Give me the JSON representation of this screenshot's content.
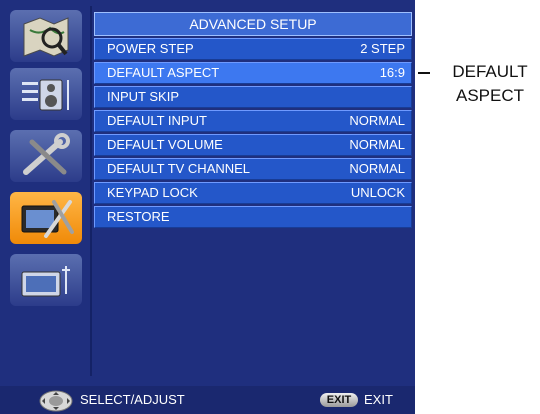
{
  "menu": {
    "title": "ADVANCED SETUP",
    "rows": [
      {
        "label": "POWER STEP",
        "value": "2 STEP"
      },
      {
        "label": "DEFAULT ASPECT",
        "value": "16:9"
      },
      {
        "label": "INPUT SKIP",
        "value": ""
      },
      {
        "label": "DEFAULT INPUT",
        "value": "NORMAL"
      },
      {
        "label": "DEFAULT VOLUME",
        "value": "NORMAL"
      },
      {
        "label": "DEFAULT TV CHANNEL",
        "value": "NORMAL"
      },
      {
        "label": "KEYPAD LOCK",
        "value": "UNLOCK"
      },
      {
        "label": "RESTORE",
        "value": ""
      }
    ]
  },
  "sidebar": {
    "icons": [
      {
        "name": "map-icon",
        "active": false
      },
      {
        "name": "speaker-equalizer-icon",
        "active": false
      },
      {
        "name": "tools-icon",
        "active": false
      },
      {
        "name": "tv-tools-icon",
        "active": true
      },
      {
        "name": "tv-antenna-icon",
        "active": false
      }
    ]
  },
  "footer": {
    "select_label": "SELECT/ADJUST",
    "exit_key": "EXIT",
    "exit_label": "EXIT"
  },
  "callout": {
    "line1": "DEFAULT",
    "line2": "ASPECT"
  },
  "colors": {
    "background": "#1f2f7e",
    "row": "#2457c9",
    "active_icon": "#f08a08"
  }
}
